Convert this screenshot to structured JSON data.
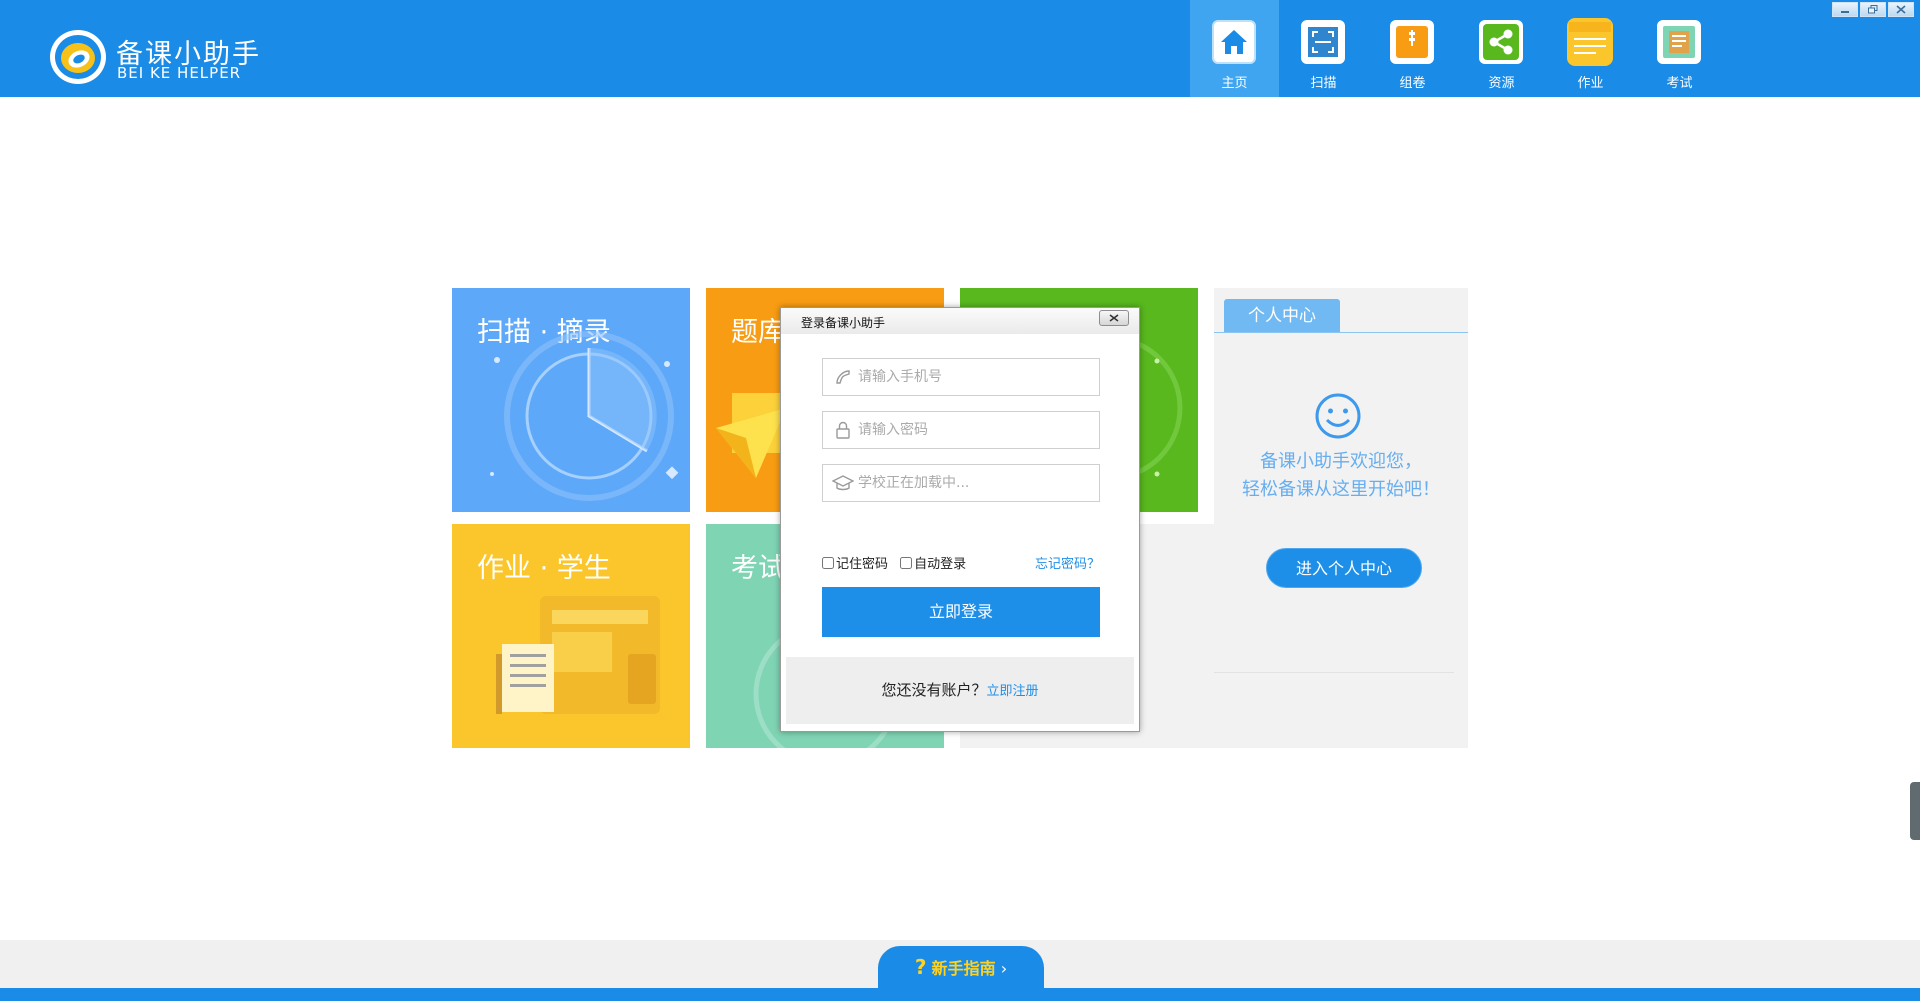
{
  "app": {
    "brand_cn": "备课小助手",
    "brand_en": "BEI KE HELPER"
  },
  "nav": [
    {
      "label": "主页",
      "icon": "home-icon",
      "color": "#ffffff",
      "active": true
    },
    {
      "label": "扫描",
      "icon": "scan-icon",
      "color": "#ffffff",
      "active": false
    },
    {
      "label": "组卷",
      "icon": "paper-icon",
      "color": "#f89c13",
      "active": false
    },
    {
      "label": "资源",
      "icon": "share-icon",
      "color": "#58b81e",
      "active": false
    },
    {
      "label": "作业",
      "icon": "notebook-icon",
      "color": "#fbc62c",
      "active": false
    },
    {
      "label": "考试",
      "icon": "exam-icon",
      "color": "#7fd4b4",
      "active": false
    }
  ],
  "tiles": {
    "scan": {
      "title": "扫描 · 摘录",
      "color": "#5da8f8"
    },
    "bank": {
      "title": "题库",
      "color": "#f89c13"
    },
    "green": {
      "color": "#58b81e"
    },
    "homework": {
      "title": "作业 · 学生",
      "color": "#fbc62c"
    },
    "exam": {
      "title": "考试",
      "color": "#7fd4b4"
    }
  },
  "personal_center": {
    "tab": "个人中心",
    "welcome_line1": "备课小助手欢迎您，",
    "welcome_line2": "轻松备课从这里开始吧！",
    "button": "进入个人中心"
  },
  "login_dialog": {
    "title": "登录备课小助手",
    "phone_placeholder": "请输入手机号",
    "password_placeholder": "请输入密码",
    "school_placeholder": "学校正在加载中...",
    "remember_label": "记住密码",
    "auto_login_label": "自动登录",
    "forgot_label": "忘记密码？",
    "login_button": "立即登录",
    "no_account_text": "您还没有账户？",
    "register_link": "立即注册"
  },
  "footer": {
    "guide_icon": "?",
    "guide_label": "新手指南",
    "guide_arrow": "›"
  }
}
